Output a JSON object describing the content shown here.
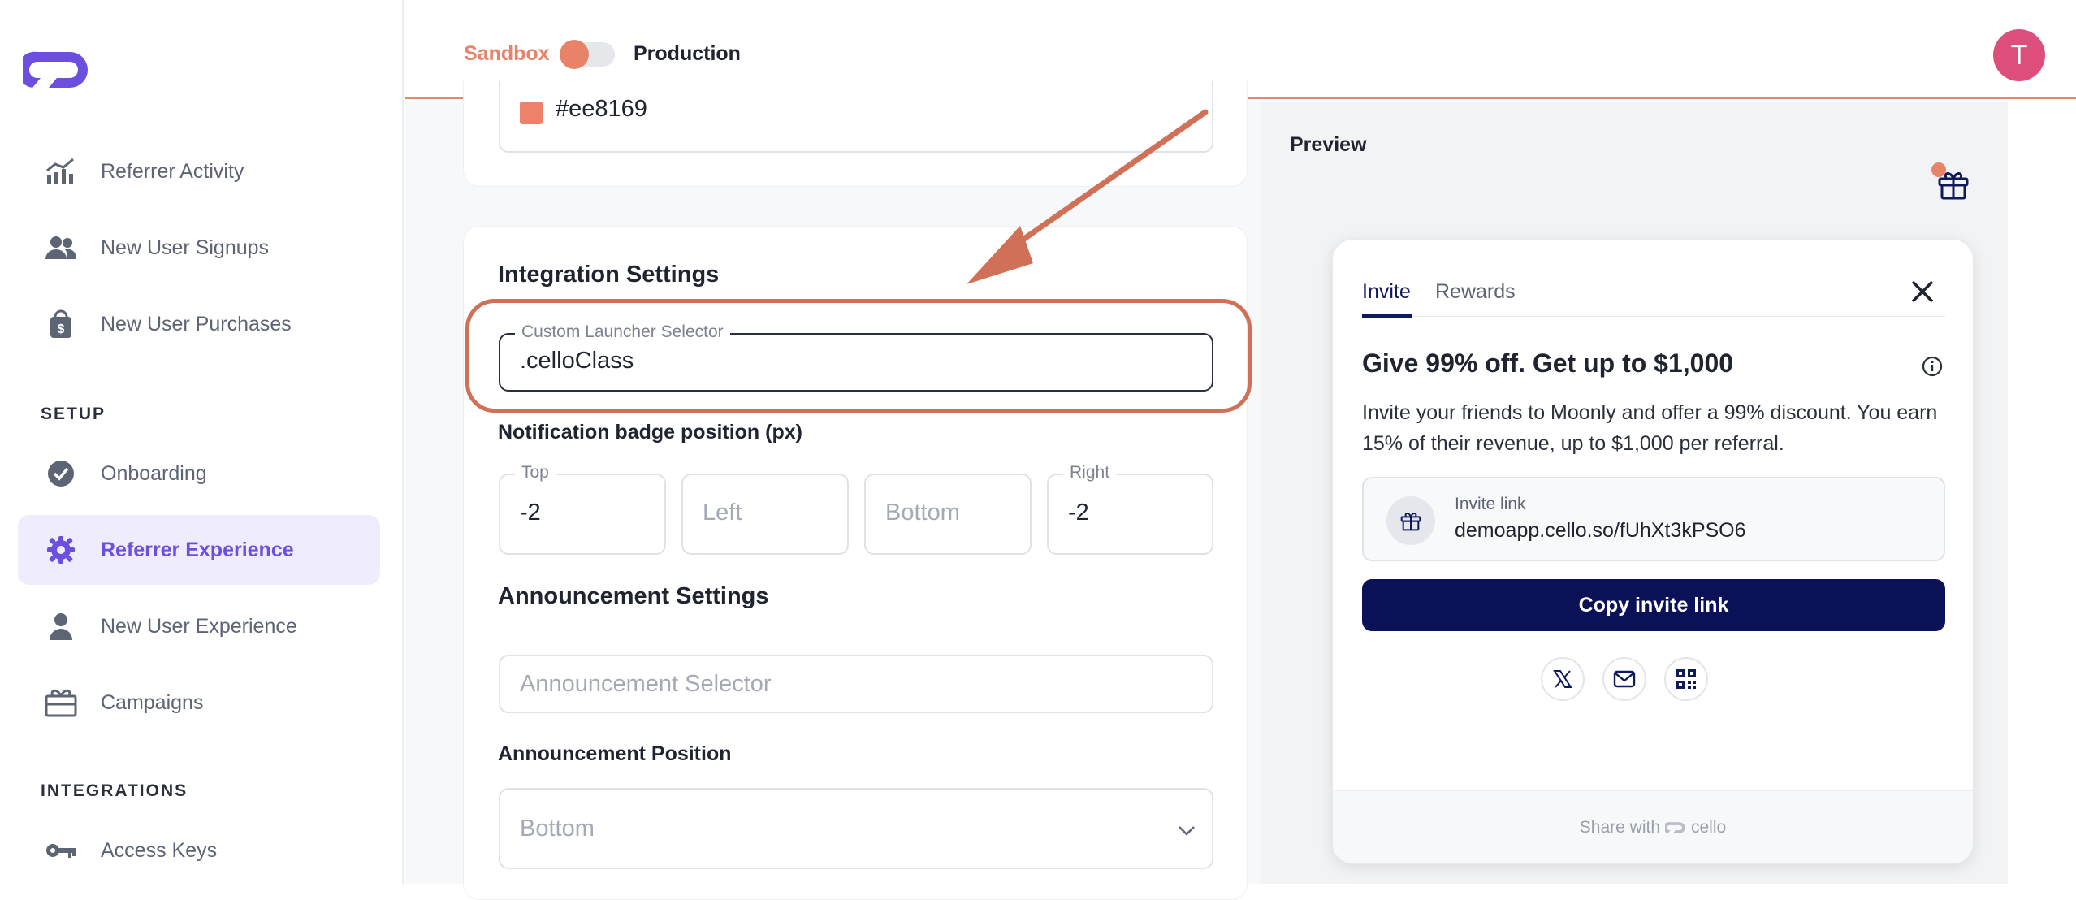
{
  "header": {
    "env_sandbox": "Sandbox",
    "env_production": "Production",
    "avatar_initial": "T"
  },
  "sidebar": {
    "items": [
      {
        "label": "Referrer Activity",
        "icon": "chart-icon"
      },
      {
        "label": "New User Signups",
        "icon": "users-icon"
      },
      {
        "label": "New User Purchases",
        "icon": "shopping-bag-icon"
      }
    ],
    "setup_title": "SETUP",
    "setup_items": [
      {
        "label": "Onboarding",
        "icon": "check-circle-icon"
      },
      {
        "label": "Referrer Experience",
        "icon": "gear-icon",
        "active": true
      },
      {
        "label": "New User Experience",
        "icon": "person-icon"
      },
      {
        "label": "Campaigns",
        "icon": "gift-box-icon"
      }
    ],
    "integrations_title": "INTEGRATIONS",
    "integrations_items": [
      {
        "label": "Access Keys",
        "icon": "key-icon"
      }
    ]
  },
  "main": {
    "color_value": "#ee8169",
    "integration_settings_title": "Integration Settings",
    "custom_launcher": {
      "legend": "Custom Launcher Selector",
      "value": ".celloClass"
    },
    "badge_position_title": "Notification badge position (px)",
    "badge_fields": [
      {
        "legend": "Top",
        "value": "-2",
        "placeholder": ""
      },
      {
        "legend": "",
        "value": "",
        "placeholder": "Left"
      },
      {
        "legend": "",
        "value": "",
        "placeholder": "Bottom"
      },
      {
        "legend": "Right",
        "value": "-2",
        "placeholder": ""
      }
    ],
    "announcement_settings_title": "Announcement Settings",
    "announcement_selector_placeholder": "Announcement Selector",
    "announcement_position_title": "Announcement Position",
    "announcement_position_value": "Bottom"
  },
  "preview": {
    "title": "Preview",
    "tabs": [
      "Invite",
      "Rewards"
    ],
    "headline": "Give 99% off. Get up to $1,000",
    "description": "Invite your friends to Moonly and offer a 99% discount. You earn 15% of their revenue, up to $1,000 per referral.",
    "invite_link_label": "Invite link",
    "invite_link_value": "demoapp.cello.so/fUhXt3kPSO6",
    "copy_button": "Copy invite link",
    "footer_share_with": "Share with",
    "footer_brand": "cello"
  },
  "colors": {
    "accent": "#e8836a",
    "primary_purple": "#6d4fe0",
    "navy": "#0a1157",
    "swatch": "#ee8169",
    "avatar": "#dd4f7a"
  }
}
